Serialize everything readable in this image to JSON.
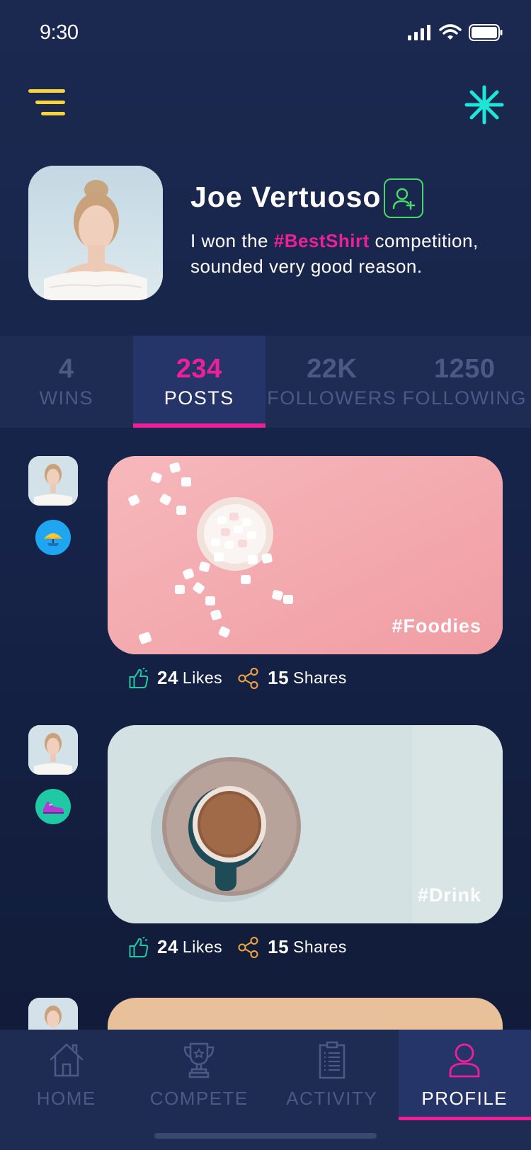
{
  "status_bar": {
    "time": "9:30"
  },
  "profile": {
    "name": "Joe Vertuoso",
    "bio_before": "I won the ",
    "bio_hashtag": "#BestShirt",
    "bio_after": " competition, sounded very good reason."
  },
  "stats": [
    {
      "value": "4",
      "label": "WINS",
      "active": false
    },
    {
      "value": "234",
      "label": "POSTS",
      "active": true
    },
    {
      "value": "22K",
      "label": "FOLLOWERS",
      "active": false
    },
    {
      "value": "1250",
      "label": "FOLLOWING",
      "active": false
    }
  ],
  "posts": [
    {
      "tag": "#Foodies",
      "likes_count": "24",
      "likes_label": "Likes",
      "shares_count": "15",
      "shares_label": "Shares",
      "badge_icon": "umbrella-icon",
      "badge_color": "#1fa6f0"
    },
    {
      "tag": "#Drink",
      "likes_count": "24",
      "likes_label": "Likes",
      "shares_count": "15",
      "shares_label": "Shares",
      "badge_icon": "sneaker-icon",
      "badge_color": "#1ec9a4"
    },
    {
      "tag": "",
      "badge_icon": "",
      "badge_color": ""
    }
  ],
  "nav": [
    {
      "label": "HOME",
      "icon": "home-icon",
      "active": false
    },
    {
      "label": "COMPETE",
      "icon": "trophy-icon",
      "active": false
    },
    {
      "label": "ACTIVITY",
      "icon": "clipboard-icon",
      "active": false
    },
    {
      "label": "PROFILE",
      "icon": "user-icon",
      "active": true
    }
  ],
  "colors": {
    "accent": "#ee1f97",
    "menu": "#f8d43a",
    "spark": "#1ee6d6",
    "add_friend": "#4bd66a",
    "likes": "#1ec9a4",
    "shares": "#f4a640"
  }
}
